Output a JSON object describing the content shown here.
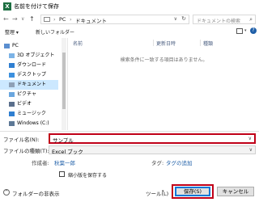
{
  "window": {
    "title": "名前を付けて保存",
    "app_icon": "X"
  },
  "nav": {
    "back_icon": "←",
    "forward_icon": "→",
    "recent_icon": "∨",
    "up_icon": "↑",
    "address_segments": [
      "PC",
      "ドキュメント"
    ],
    "address_separator": "›",
    "address_dropdown": "∨",
    "refresh_icon": "↻",
    "search_placeholder": "ドキュメントの検索",
    "search_icon": "⌕"
  },
  "toolbar": {
    "organize": "整理 ▾",
    "new_folder": "新しいフォルダー",
    "help": "?"
  },
  "sidebar": {
    "items": [
      {
        "label": "PC",
        "icon_color": "#5b8fd0"
      },
      {
        "label": "3D オブジェクト",
        "icon_color": "#7cb3e6"
      },
      {
        "label": "ダウンロード",
        "icon_color": "#2f7fd1"
      },
      {
        "label": "デスクトップ",
        "icon_color": "#3c90de"
      },
      {
        "label": "ドキュメント",
        "icon_color": "#8ea0b6"
      },
      {
        "label": "ピクチャ",
        "icon_color": "#6aa6de"
      },
      {
        "label": "ビデオ",
        "icon_color": "#5a6f8c"
      },
      {
        "label": "ミュージック",
        "icon_color": "#2f7fd1"
      },
      {
        "label": "Windows (C:)",
        "icon_color": "#5d7896"
      }
    ],
    "selected_index": 4
  },
  "filelist": {
    "columns": [
      "名前",
      "更新日時",
      "種類"
    ],
    "empty_message": "検索条件に一致する項目はありません。"
  },
  "form": {
    "filename_label": "ファイル名(N):",
    "filename_value": "サンプル",
    "filename_dropdown": "∨",
    "filetype_label": "ファイルの種類(T):",
    "filetype_value": "Excel ブック",
    "filetype_dropdown": "∨",
    "author_label": "作成者:",
    "author_value": "秋葉一郎",
    "tags_label": "タグ:",
    "tags_value": "タグの追加",
    "thumbnail_label": "縮小版を保存する"
  },
  "footer": {
    "hide_folders": "フォルダーの非表示",
    "chevron": "^",
    "tools": "ツール(L)",
    "tools_dropdown": "▾",
    "save": "保存(S)",
    "cancel": "キャンセル"
  },
  "colors": {
    "accent_red": "#c00018",
    "selection": "#cce8ff",
    "link": "#1f5fa8",
    "excel_green": "#1d6f42"
  }
}
